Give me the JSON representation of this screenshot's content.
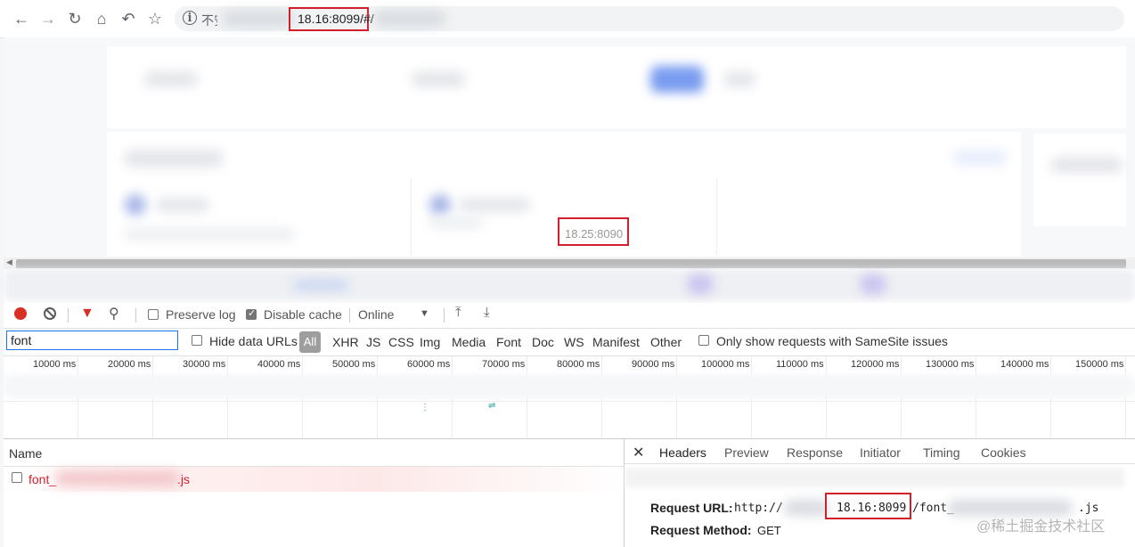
{
  "browser": {
    "security_label": "不安全",
    "url_host": "18.16:8099/#/"
  },
  "page": {
    "server_label": "18.25:8090"
  },
  "devtools": {
    "preserve_log": "Preserve log",
    "disable_cache": "Disable cache",
    "throttling": "Online",
    "filter_value": "font",
    "hide_data_urls": "Hide data URLs",
    "types": [
      "All",
      "XHR",
      "JS",
      "CSS",
      "Img",
      "Media",
      "Font",
      "Doc",
      "WS",
      "Manifest",
      "Other"
    ],
    "samesite_label": "Only show requests with SameSite issues",
    "ticks": [
      "10000 ms",
      "20000 ms",
      "30000 ms",
      "40000 ms",
      "50000 ms",
      "60000 ms",
      "70000 ms",
      "80000 ms",
      "90000 ms",
      "100000 ms",
      "110000 ms",
      "120000 ms",
      "130000 ms",
      "140000 ms",
      "150000 ms"
    ],
    "name_header": "Name",
    "row": {
      "name_prefix": "font_",
      "name_suffix": ".js"
    },
    "detail_tabs": [
      "Headers",
      "Preview",
      "Response",
      "Initiator",
      "Timing",
      "Cookies"
    ],
    "request_url_label": "Request URL:",
    "request_url_scheme": "http://",
    "request_url_host": "18.16:8099",
    "request_url_path": "/font_",
    "request_url_ext": ".js",
    "request_method_label": "Request Method:",
    "request_method_value": "GET"
  },
  "watermark": "@稀土掘金技术社区",
  "colors": {
    "highlight_box": "#d21f2b",
    "record": "#d93025",
    "link_error": "#d21f2b"
  }
}
